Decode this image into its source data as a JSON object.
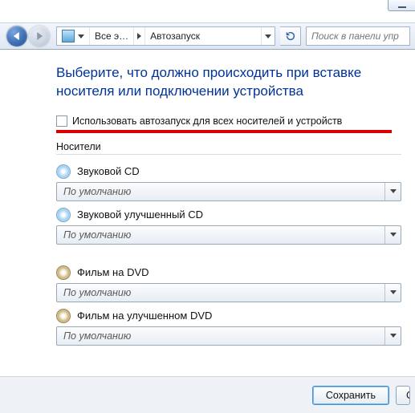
{
  "nav": {
    "breadcrumb_1": "Все э…",
    "breadcrumb_2": "Автозапуск",
    "search_placeholder": "Поиск в панели упр"
  },
  "heading": "Выберите, что должно происходить при вставке носителя или подключении устройства",
  "master_checkbox_label": "Использовать автозапуск для всех носителей и устройств",
  "section_label": "Носители",
  "default_value": "По умолчанию",
  "media": [
    {
      "label": "Звуковой CD",
      "icon": "cd"
    },
    {
      "label": "Звуковой улучшенный CD",
      "icon": "cd"
    },
    {
      "label": "Фильм на DVD",
      "icon": "dvd"
    },
    {
      "label": "Фильм на улучшенном DVD",
      "icon": "dvd"
    }
  ],
  "buttons": {
    "save": "Сохранить",
    "cancel": "О"
  }
}
